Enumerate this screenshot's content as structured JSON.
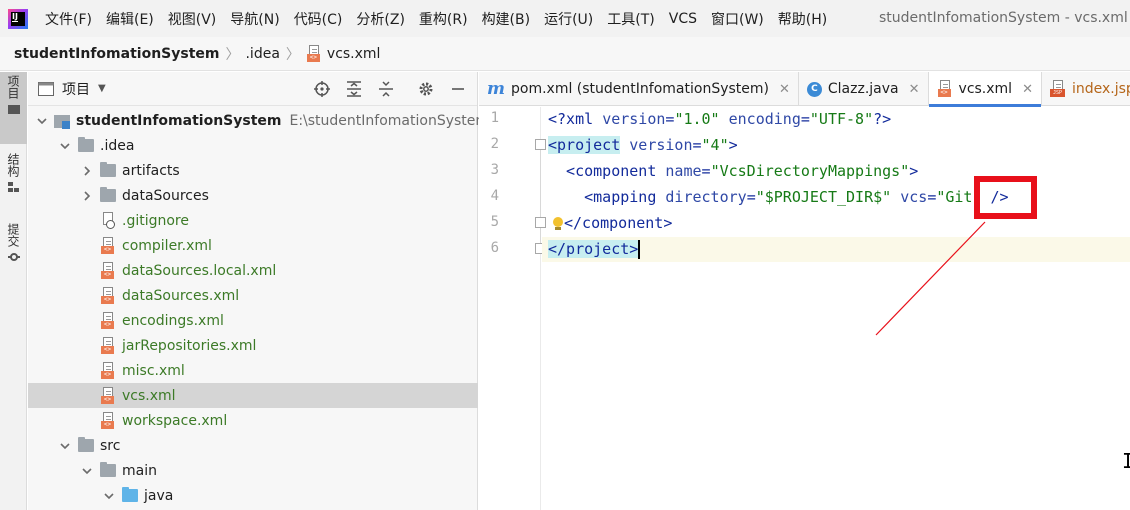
{
  "menu": {
    "items": [
      "文件(F)",
      "编辑(E)",
      "视图(V)",
      "导航(N)",
      "代码(C)",
      "分析(Z)",
      "重构(R)",
      "构建(B)",
      "运行(U)",
      "工具(T)",
      "VCS",
      "窗口(W)",
      "帮助(H)"
    ],
    "window_title": "studentInfomationSystem - vcs.xml"
  },
  "breadcrumb": {
    "project": "studentInfomationSystem",
    "folder": ".idea",
    "file": "vcs.xml"
  },
  "toolstrip": {
    "project": "项目",
    "structure": "结构",
    "commit": "提交"
  },
  "project_panel": {
    "title": "项目",
    "tools": [
      "target-icon",
      "expand-all-icon",
      "collapse-all-icon",
      "gear-icon",
      "minimize-icon"
    ],
    "tree": {
      "root": {
        "label": "studentInfomationSystem",
        "path": "E:\\studentInfomationSystem"
      },
      "idea": ".idea",
      "artifacts": "artifacts",
      "dataSources": "dataSources",
      "gitignore": ".gitignore",
      "files": [
        "compiler.xml",
        "dataSources.local.xml",
        "dataSources.xml",
        "encodings.xml",
        "jarRepositories.xml",
        "misc.xml",
        "vcs.xml",
        "workspace.xml"
      ],
      "src": "src",
      "main": "main",
      "java": "java"
    }
  },
  "editor": {
    "tabs": [
      {
        "label": "pom.xml (studentInfomationSystem)",
        "icon": "maven-icon",
        "active": false
      },
      {
        "label": "Clazz.java",
        "icon": "class-icon",
        "active": false
      },
      {
        "label": "vcs.xml",
        "icon": "xml-file-icon",
        "active": true
      },
      {
        "label": "index.jsp",
        "icon": "jsp-file-icon",
        "active": false
      }
    ],
    "line_numbers": [
      "1",
      "2",
      "3",
      "4",
      "5",
      "6"
    ],
    "code": {
      "l1_open": "<?xml ",
      "l1_attr1": "version",
      "l1_eq1": "=",
      "l1_val1": "\"1.0\"",
      "l1_attr2": " encoding",
      "l1_eq2": "=",
      "l1_val2": "\"UTF-8\"",
      "l1_close": "?>",
      "l2_tag": "<project",
      "l2_attr": " version",
      "l2_val": "\"4\"",
      "l2_close": ">",
      "l3_tag": "  <component",
      "l3_attr": " name",
      "l3_val": "\"VcsDirectoryMappings\"",
      "l3_close": ">",
      "l4_tag": "    <mapping",
      "l4_attr1": " directory",
      "l4_val1": "\"$PROJECT_DIR$\"",
      "l4_attr2": " vcs",
      "l4_val2": "\"Git\"",
      "l4_close": " />",
      "l5_tag": "</component>",
      "l6_tag": "</project",
      "l6_close": ">"
    },
    "tab_close_glyph": "✕"
  },
  "colors": {
    "annotation": "#e8101a",
    "accent": "#3d7cd9"
  }
}
